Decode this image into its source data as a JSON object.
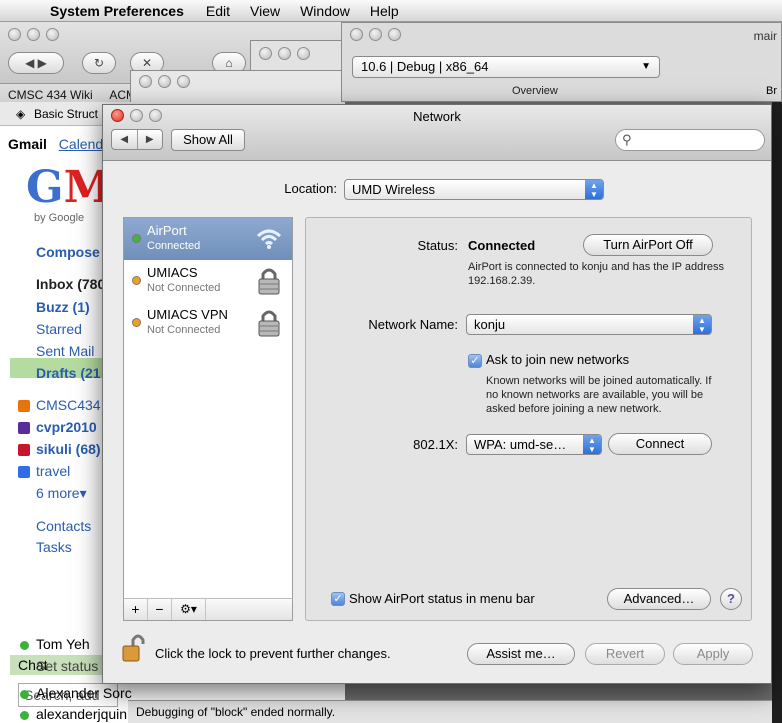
{
  "menubar": {
    "app": "System Preferences",
    "items": [
      "Edit",
      "View",
      "Window",
      "Help"
    ]
  },
  "browser": {
    "bookmarks": [
      "CMSC 434 Wiki",
      "ACM"
    ],
    "tab_title": "Basic Struct",
    "gmail": {
      "tab_gmail": "Gmail",
      "tab_calendar": "Calend",
      "logo": "GM",
      "by_google": "by Google",
      "compose": "Compose",
      "inbox": "Inbox (780",
      "buzz": "Buzz (1)",
      "starred": "Starred",
      "sent": "Sent Mail",
      "drafts": "Drafts (21",
      "labels": [
        {
          "name": "CMSC434",
          "color": "#e8720c"
        },
        {
          "name": "cvpr2010",
          "color": "#5a2d9a"
        },
        {
          "name": "sikuli (68)",
          "color": "#c7152b"
        },
        {
          "name": "travel",
          "color": "#2f6ee8"
        }
      ],
      "more": "6 more▾",
      "contacts": "Contacts",
      "tasks": "Tasks",
      "chat": "Chat",
      "chat_search_placeholder": "Search, add",
      "me": "Tom Yeh",
      "set_status": "Set status",
      "contacts_list": [
        "Alexander Sorc",
        "alexanderjquinr"
      ]
    }
  },
  "xcode": {
    "scheme": "10.6 | Debug | x86_64",
    "overview": "Overview",
    "main": "mair",
    "br": "Br",
    "status": "Debugging of \"block\" ended normally."
  },
  "network": {
    "title": "Network",
    "show_all": "Show All",
    "location_label": "Location:",
    "location": "UMD Wireless",
    "services": [
      {
        "name": "AirPort",
        "status": "Connected",
        "dot": "#3fb83a",
        "selected": true,
        "icon": "wifi-icon"
      },
      {
        "name": "UMIACS",
        "status": "Not Connected",
        "dot": "#f0a020",
        "selected": false,
        "icon": "lock-icon"
      },
      {
        "name": "UMIACS VPN",
        "status": "Not Connected",
        "dot": "#f0a020",
        "selected": false,
        "icon": "lock-icon"
      }
    ],
    "status_label": "Status:",
    "status_value": "Connected",
    "turn_off": "Turn AirPort Off",
    "status_desc": "AirPort is connected to konju and has the IP address 192.168.2.39.",
    "network_name_label": "Network Name:",
    "network_name": "konju",
    "ask_join": "Ask to join new networks",
    "ask_desc": "Known networks will be joined automatically. If no known networks are available, you will be asked before joining a new network.",
    "dot1x_label": "802.1X:",
    "dot1x_value": "WPA: umd-se…",
    "connect": "Connect",
    "show_status": "Show AirPort status in menu bar",
    "advanced": "Advanced…",
    "help": "?",
    "lock_text": "Click the lock to prevent further changes.",
    "assist": "Assist me…",
    "revert": "Revert",
    "apply": "Apply"
  }
}
